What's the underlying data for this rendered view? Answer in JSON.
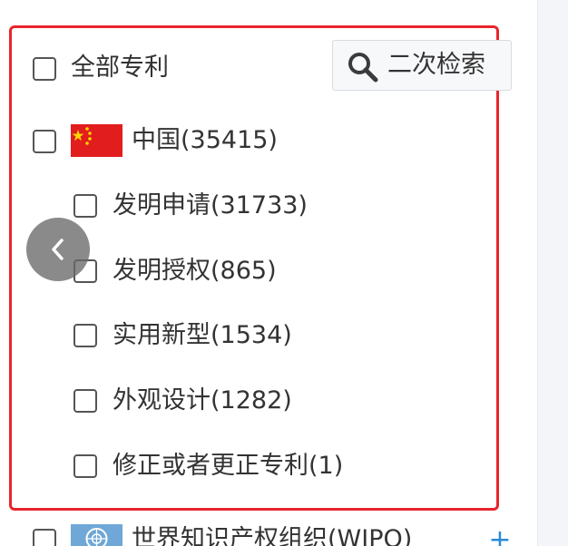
{
  "header": {
    "all_patents_label": "全部专利",
    "secondary_search_label": "二次检索"
  },
  "countries": [
    {
      "name_count": "中国(35415)",
      "flag_icon": "china-flag-icon"
    },
    {
      "name_count": "世界知识产权组织(WIPO)",
      "flag_icon": "wipo-flag-icon"
    }
  ],
  "china_types": [
    {
      "label": "发明申请(31733)"
    },
    {
      "label": "发明授权(865)"
    },
    {
      "label": "实用新型(1534)"
    },
    {
      "label": "外观设计(1282)"
    },
    {
      "label": "修正或者更正专利(1)"
    }
  ],
  "icons": {
    "search": "search-icon",
    "back": "chevron-left-icon",
    "plus": "plus-icon"
  },
  "colors": {
    "highlight_border": "#e8252c",
    "flag_red": "#e11d1d",
    "plus_blue": "#2a8bd7"
  }
}
